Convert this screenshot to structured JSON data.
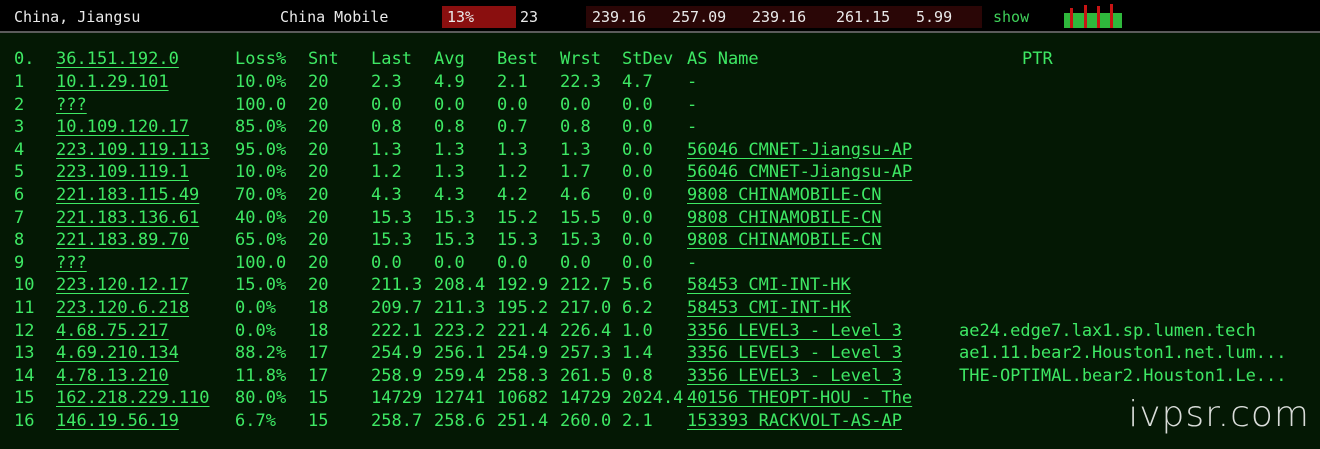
{
  "header": {
    "location": "China, Jiangsu",
    "isp": "China Mobile",
    "loss": "13%",
    "snt": "23",
    "last": "239.16",
    "avg": "257.09",
    "best": "239.16",
    "wrst": "261.15",
    "stdev": "5.99",
    "show_label": "show",
    "loss_color": "#8a0f0f",
    "show_color": "#3fd05a"
  },
  "columns": {
    "hop": "0.",
    "ip": "36.151.192.0",
    "loss": "Loss%",
    "snt": "Snt",
    "last": "Last",
    "avg": "Avg",
    "best": "Best",
    "wrst": "Wrst",
    "stdev": "StDev",
    "as": "AS Name",
    "ptr": "PTR"
  },
  "hops": [
    {
      "hop": "1",
      "ip": "10.1.29.101",
      "loss": "10.0%",
      "snt": "20",
      "last": "2.3",
      "avg": "4.9",
      "best": "2.1",
      "wrst": "22.3",
      "stdev": "4.7",
      "as": "-",
      "ptr": ""
    },
    {
      "hop": "2",
      "ip": "???",
      "loss": "100.0",
      "snt": "20",
      "last": "0.0",
      "avg": "0.0",
      "best": "0.0",
      "wrst": "0.0",
      "stdev": "0.0",
      "as": "-",
      "ptr": ""
    },
    {
      "hop": "3",
      "ip": "10.109.120.17",
      "loss": "85.0%",
      "snt": "20",
      "last": "0.8",
      "avg": "0.8",
      "best": "0.7",
      "wrst": "0.8",
      "stdev": "0.0",
      "as": "-",
      "ptr": ""
    },
    {
      "hop": "4",
      "ip": "223.109.119.113",
      "loss": "95.0%",
      "snt": "20",
      "last": "1.3",
      "avg": "1.3",
      "best": "1.3",
      "wrst": "1.3",
      "stdev": "0.0",
      "as": "56046 CMNET-Jiangsu-AP",
      "ptr": ""
    },
    {
      "hop": "5",
      "ip": "223.109.119.1",
      "loss": "10.0%",
      "snt": "20",
      "last": "1.2",
      "avg": "1.3",
      "best": "1.2",
      "wrst": "1.7",
      "stdev": "0.0",
      "as": "56046 CMNET-Jiangsu-AP",
      "ptr": ""
    },
    {
      "hop": "6",
      "ip": "221.183.115.49",
      "loss": "70.0%",
      "snt": "20",
      "last": "4.3",
      "avg": "4.3",
      "best": "4.2",
      "wrst": "4.6",
      "stdev": "0.0",
      "as": "9808  CHINAMOBILE-CN",
      "ptr": ""
    },
    {
      "hop": "7",
      "ip": "221.183.136.61",
      "loss": "40.0%",
      "snt": "20",
      "last": "15.3",
      "avg": "15.3",
      "best": "15.2",
      "wrst": "15.5",
      "stdev": "0.0",
      "as": "9808  CHINAMOBILE-CN",
      "ptr": ""
    },
    {
      "hop": "8",
      "ip": "221.183.89.70",
      "loss": "65.0%",
      "snt": "20",
      "last": "15.3",
      "avg": "15.3",
      "best": "15.3",
      "wrst": "15.3",
      "stdev": "0.0",
      "as": "9808  CHINAMOBILE-CN",
      "ptr": ""
    },
    {
      "hop": "9",
      "ip": "???",
      "loss": "100.0",
      "snt": "20",
      "last": "0.0",
      "avg": "0.0",
      "best": "0.0",
      "wrst": "0.0",
      "stdev": "0.0",
      "as": "-",
      "ptr": ""
    },
    {
      "hop": "10",
      "ip": "223.120.12.17",
      "loss": "15.0%",
      "snt": "20",
      "last": "211.3",
      "avg": "208.4",
      "best": "192.9",
      "wrst": "212.7",
      "stdev": "5.6",
      "as": "58453 CMI-INT-HK",
      "ptr": ""
    },
    {
      "hop": "11",
      "ip": "223.120.6.218",
      "loss": "0.0%",
      "snt": "18",
      "last": "209.7",
      "avg": "211.3",
      "best": "195.2",
      "wrst": "217.0",
      "stdev": "6.2",
      "as": "58453 CMI-INT-HK",
      "ptr": ""
    },
    {
      "hop": "12",
      "ip": "4.68.75.217",
      "loss": "0.0%",
      "snt": "18",
      "last": "222.1",
      "avg": "223.2",
      "best": "221.4",
      "wrst": "226.4",
      "stdev": "1.0",
      "as": "3356  LEVEL3 - Level 3",
      "ptr": "ae24.edge7.lax1.sp.lumen.tech"
    },
    {
      "hop": "13",
      "ip": "4.69.210.134",
      "loss": "88.2%",
      "snt": "17",
      "last": "254.9",
      "avg": "256.1",
      "best": "254.9",
      "wrst": "257.3",
      "stdev": "1.4",
      "as": "3356  LEVEL3 - Level 3",
      "ptr": "ae1.11.bear2.Houston1.net.lum..."
    },
    {
      "hop": "14",
      "ip": "4.78.13.210",
      "loss": "11.8%",
      "snt": "17",
      "last": "258.9",
      "avg": "259.4",
      "best": "258.3",
      "wrst": "261.5",
      "stdev": "0.8",
      "as": "3356  LEVEL3 - Level 3",
      "ptr": "THE-OPTIMAL.bear2.Houston1.Le..."
    },
    {
      "hop": "15",
      "ip": "162.218.229.110",
      "loss": "80.0%",
      "snt": "15",
      "last": "14729",
      "avg": "12741",
      "best": "10682",
      "wrst": "14729",
      "stdev": "2024.4",
      "as": "40156 THEOPT-HOU - The",
      "ptr": ""
    },
    {
      "hop": "16",
      "ip": "146.19.56.19",
      "loss": "6.7%",
      "snt": "15",
      "last": "258.7",
      "avg": "258.6",
      "best": "251.4",
      "wrst": "260.0",
      "stdev": "2.1",
      "as": "153393 RACKVOLT-AS-AP",
      "ptr": ""
    }
  ],
  "watermark": "ivpsr.com"
}
